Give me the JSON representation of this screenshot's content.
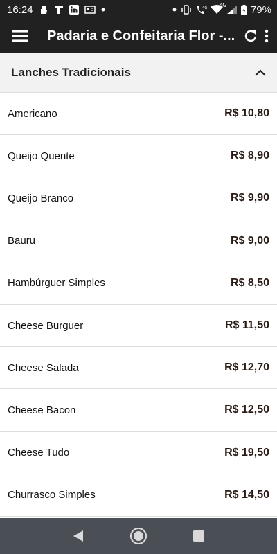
{
  "status_bar": {
    "time": "16:24",
    "network_label": "4G",
    "battery_percent": "79%"
  },
  "app_bar": {
    "title": "Padaria e Confeitaria Flor -..."
  },
  "section": {
    "title": "Lanches Tradicionais",
    "expanded": true
  },
  "items": [
    {
      "name": "Americano",
      "price": "R$ 10,80"
    },
    {
      "name": "Queijo Quente",
      "price": "R$ 8,90"
    },
    {
      "name": "Queijo Branco",
      "price": "R$ 9,90"
    },
    {
      "name": "Bauru",
      "price": "R$ 9,00"
    },
    {
      "name": "Hambúrguer Simples",
      "price": "R$ 8,50"
    },
    {
      "name": "Cheese Burguer",
      "price": "R$ 11,50"
    },
    {
      "name": "Cheese Salada",
      "price": "R$ 12,70"
    },
    {
      "name": "Cheese Bacon",
      "price": "R$ 12,50"
    },
    {
      "name": "Cheese Tudo",
      "price": "R$ 19,50"
    },
    {
      "name": "Churrasco Simples",
      "price": "R$ 14,50"
    }
  ],
  "icons": {
    "menu": "hamburger-menu-icon",
    "refresh": "refresh-icon",
    "more": "more-vert-icon",
    "collapse": "chevron-up-icon",
    "back": "nav-back-icon",
    "home": "nav-home-icon",
    "recents": "nav-recents-icon"
  },
  "colors": {
    "app_bar": "#212121",
    "section_bg": "#f2f2f2",
    "nav_bar": "#4a4f55",
    "price_text": "#2a1a14"
  }
}
